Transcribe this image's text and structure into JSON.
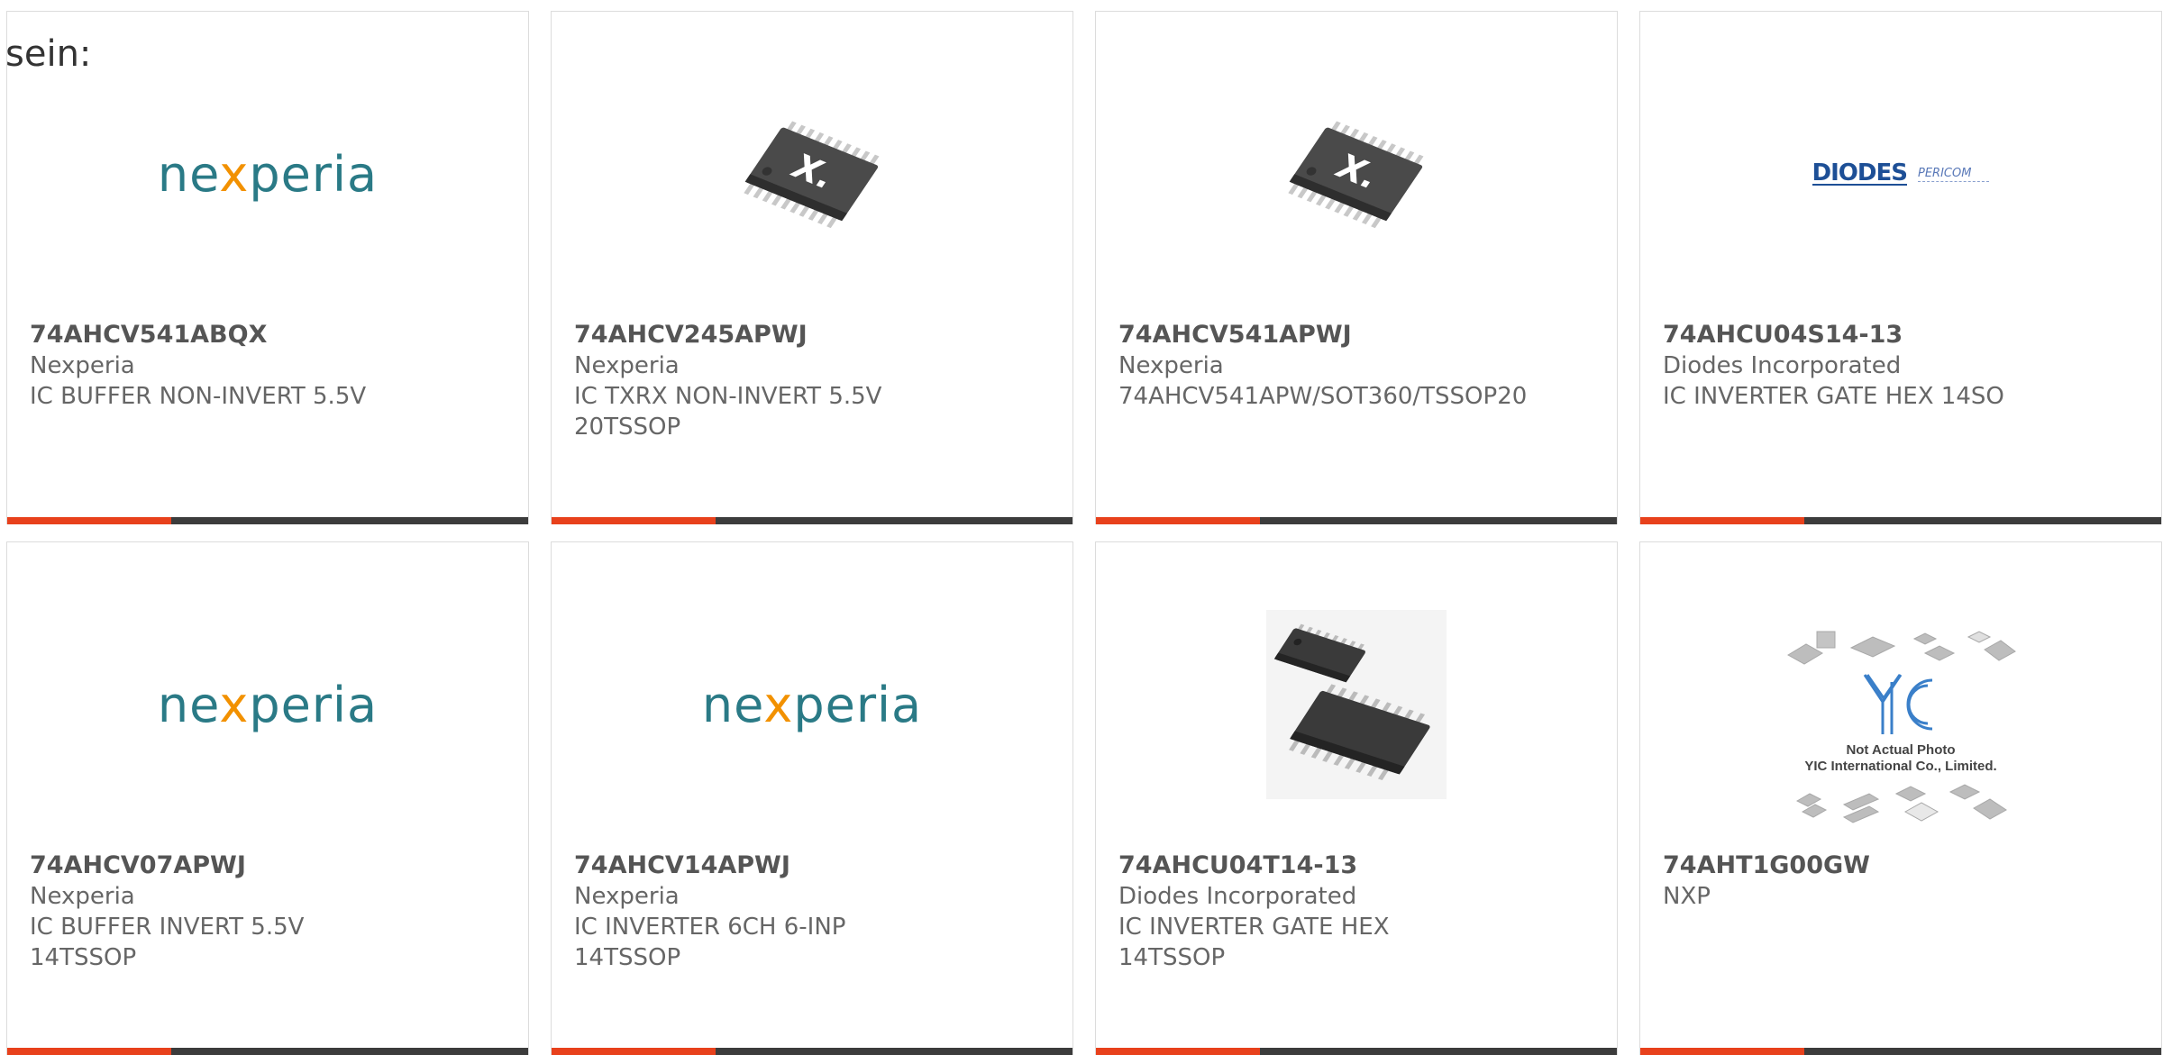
{
  "intro_text": "sein:",
  "products": [
    {
      "part": "74AHCV541ABQX",
      "manufacturer": "Nexperia",
      "desc1": "IC BUFFER NON-INVERT 5.5V",
      "desc2": "",
      "image": "nexperia-logo"
    },
    {
      "part": "74AHCV245APWJ",
      "manufacturer": "Nexperia",
      "desc1": "IC TXRX NON-INVERT 5.5V",
      "desc2": "20TSSOP",
      "image": "tssop-chip-photo"
    },
    {
      "part": "74AHCV541APWJ",
      "manufacturer": "Nexperia",
      "desc1": "74AHCV541APW/SOT360/TSSOP20",
      "desc2": "",
      "image": "tssop-chip-photo"
    },
    {
      "part": "74AHCU04S14-13",
      "manufacturer": "Diodes Incorporated",
      "desc1": "IC INVERTER GATE HEX 14SO",
      "desc2": "",
      "image": "diodes-pericom-logo"
    },
    {
      "part": "74AHCV07APWJ",
      "manufacturer": "Nexperia",
      "desc1": "IC BUFFER INVERT 5.5V",
      "desc2": "14TSSOP",
      "image": "nexperia-logo"
    },
    {
      "part": "74AHCV14APWJ",
      "manufacturer": "Nexperia",
      "desc1": "IC INVERTER 6CH 6-INP",
      "desc2": "14TSSOP",
      "image": "nexperia-logo"
    },
    {
      "part": "74AHCU04T14-13",
      "manufacturer": "Diodes Incorporated",
      "desc1": "IC INVERTER GATE HEX",
      "desc2": "14TSSOP",
      "image": "tssop14-chips-photo"
    },
    {
      "part": "74AHT1G00GW",
      "manufacturer": "NXP",
      "desc1": "",
      "desc2": "",
      "image": "yic-placeholder"
    }
  ],
  "logos": {
    "nexperia": {
      "pre": "ne",
      "x": "x",
      "post": "peria"
    },
    "diodes": {
      "main": "DIODES",
      "sub": "PERICOM"
    },
    "yic": {
      "mark": "YIC",
      "line1": "Not Actual Photo",
      "line2": "YIC International Co., Limited."
    }
  },
  "colors": {
    "accent": "#e8411c",
    "bar": "#3c3c3c",
    "nexperia_teal": "#2a7a86",
    "nexperia_orange": "#f29100",
    "diodes_blue": "#1d4f96"
  }
}
